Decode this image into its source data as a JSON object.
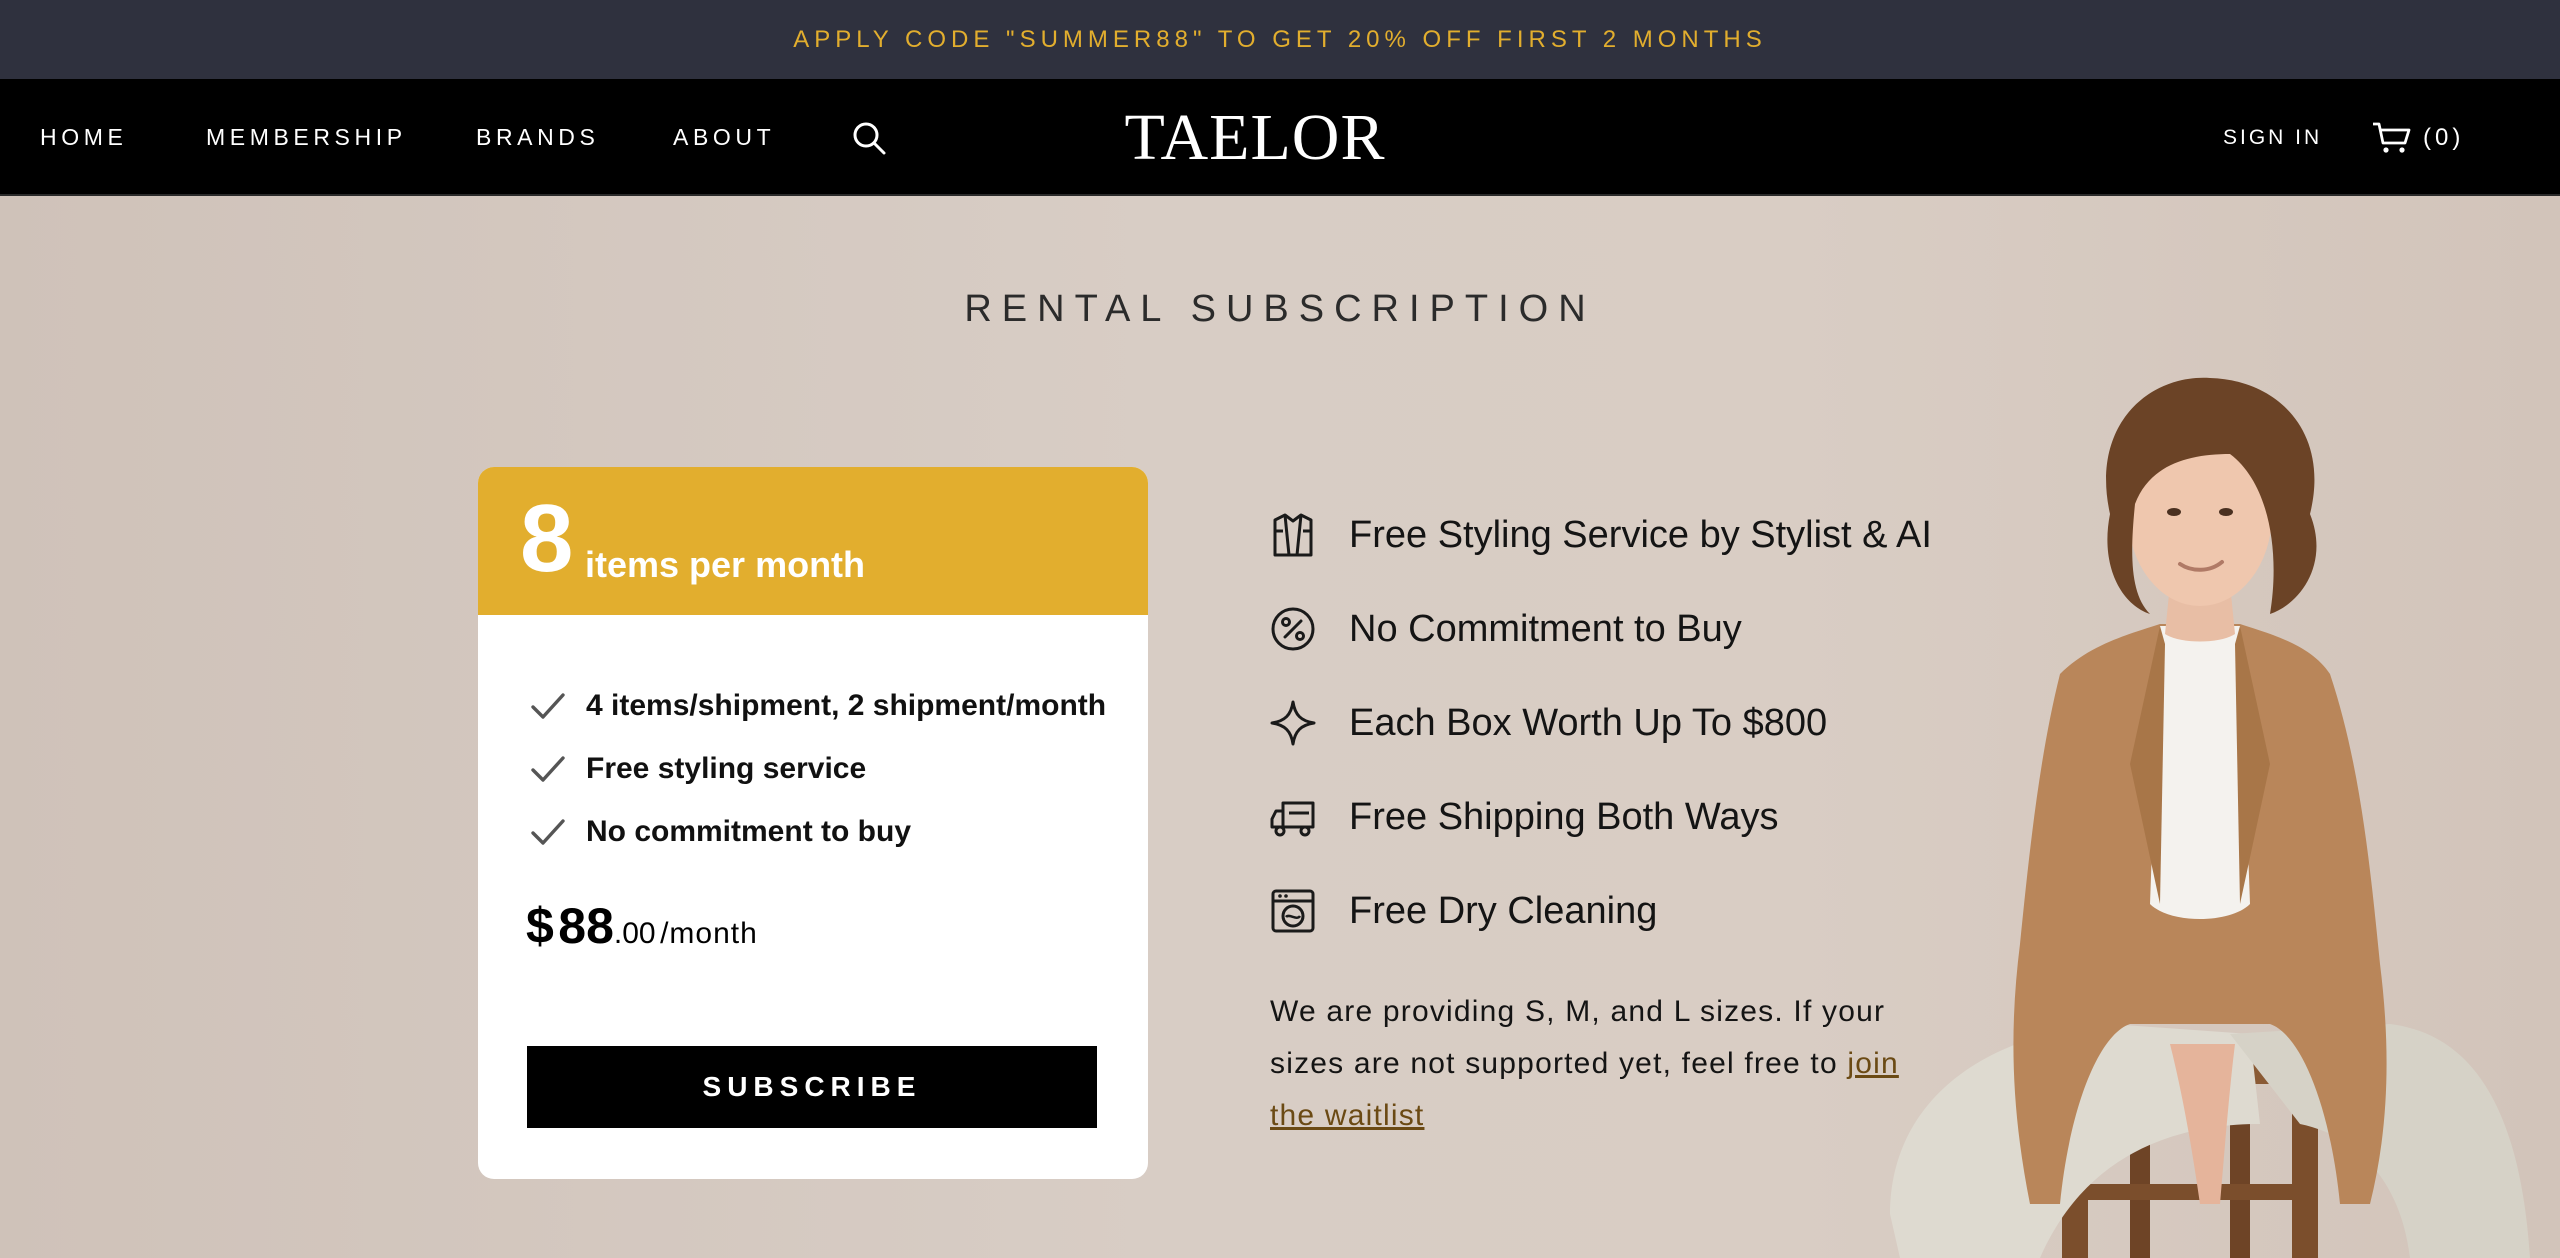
{
  "promo": {
    "text": "APPLY CODE \"SUMMER88\" TO GET 20% OFF FIRST 2 MONTHS"
  },
  "nav": {
    "items": [
      "HOME",
      "MEMBERSHIP",
      "BRANDS",
      "ABOUT"
    ],
    "logo": "TAELOR",
    "sign_in": "SIGN IN",
    "cart_count": "(0)"
  },
  "hero": {
    "title": "RENTAL SUBSCRIPTION",
    "plan": {
      "count": "8",
      "unit": "items per month",
      "features": [
        "4 items/shipment, 2 shipment/month",
        "Free styling service",
        "No commitment to buy"
      ],
      "price_currency": "$",
      "price_amount": "88",
      "price_cents": ".00",
      "price_period": "/month",
      "subscribe_label": "SUBSCRIBE"
    },
    "benefits": [
      {
        "icon": "jacket-icon",
        "label": "Free Styling Service by Stylist & AI"
      },
      {
        "icon": "percent-icon",
        "label": "No Commitment to Buy"
      },
      {
        "icon": "sparkle-icon",
        "label": "Each Box Worth Up To $800"
      },
      {
        "icon": "truck-icon",
        "label": "Free Shipping Both Ways"
      },
      {
        "icon": "washer-icon",
        "label": "Free Dry Cleaning"
      }
    ],
    "note_text": "We are providing S, M, and L sizes. If your sizes are not supported yet, feel free to",
    "note_link": "join the waitlist"
  },
  "colors": {
    "promo_bg": "#2f313e",
    "accent": "#e2ae2e",
    "nav_bg": "#000000",
    "hero_bg": "#d3c6bd",
    "link": "#6b4a14"
  }
}
